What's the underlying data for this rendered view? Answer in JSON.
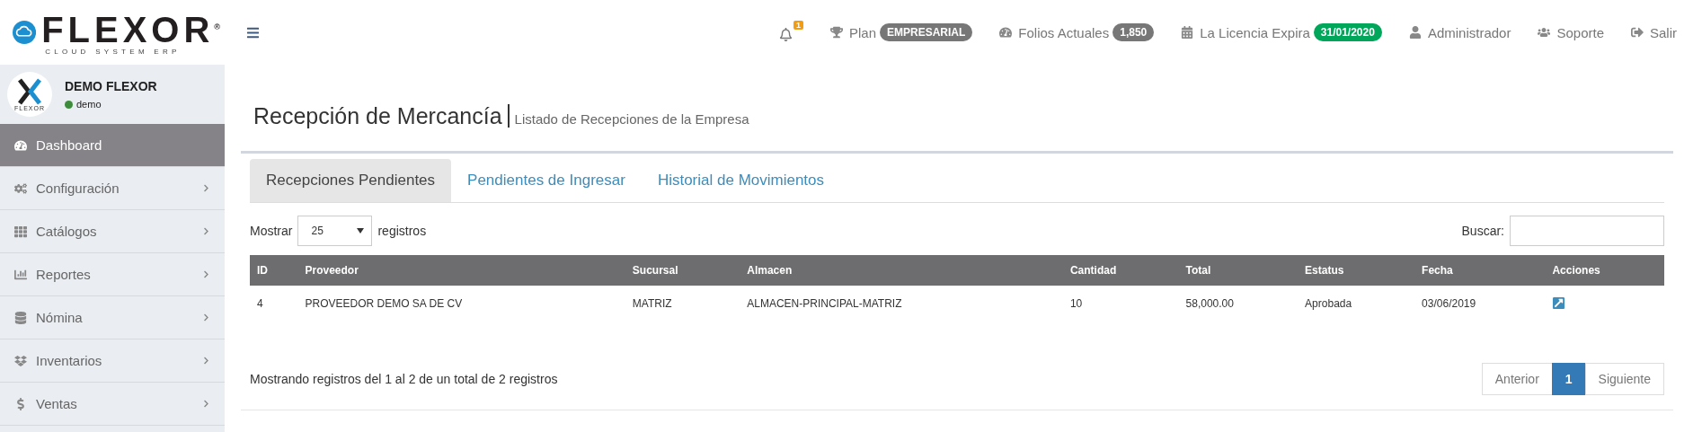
{
  "brand": {
    "name": "FLEXOR",
    "mark": "®",
    "tagline": "CLOUD SYSTEM ERP"
  },
  "topbar": {
    "notifications": "1",
    "items": [
      {
        "kind": "badge",
        "label": "Plan",
        "badge": "EMPRESARIAL",
        "color": "#777777"
      },
      {
        "kind": "badge",
        "label": "Folios Actuales",
        "badge": "1,850",
        "color": "#777777"
      },
      {
        "kind": "badge",
        "label": "La Licencia Expira",
        "badge": "31/01/2020",
        "color": "#00a65a"
      },
      {
        "kind": "link",
        "label": "Administrador"
      },
      {
        "kind": "link",
        "label": "Soporte"
      },
      {
        "kind": "link",
        "label": "Salir"
      }
    ]
  },
  "user": {
    "avatar_text": "FLEXOR",
    "name": "DEMO FLEXOR",
    "status": "demo",
    "online": true
  },
  "sidebar": {
    "items": [
      {
        "label": "Dashboard",
        "selected": true,
        "has_children": false
      },
      {
        "label": "Configuración",
        "selected": false,
        "has_children": true
      },
      {
        "label": "Catálogos",
        "selected": false,
        "has_children": true
      },
      {
        "label": "Reportes",
        "selected": false,
        "has_children": true
      },
      {
        "label": "Nómina",
        "selected": false,
        "has_children": true
      },
      {
        "label": "Inventarios",
        "selected": false,
        "has_children": true
      },
      {
        "label": "Ventas",
        "selected": false,
        "has_children": true
      }
    ]
  },
  "page": {
    "title": "Recepción de Mercancía",
    "subtitle": "Listado de Recepciones de la Empresa"
  },
  "tabs": [
    {
      "label": "Recepciones Pendientes",
      "selected": true
    },
    {
      "label": "Pendientes de Ingresar",
      "selected": false
    },
    {
      "label": "Historial de Movimientos",
      "selected": false
    }
  ],
  "length": {
    "before": "Mostrar",
    "value": "25",
    "after": "registros"
  },
  "search": {
    "label": "Buscar:"
  },
  "table": {
    "columns": [
      "ID",
      "Proveedor",
      "Sucursal",
      "Almacen",
      "Cantidad",
      "Total",
      "Estatus",
      "Fecha",
      "Acciones"
    ],
    "rows": [
      [
        "4",
        "PROVEEDOR DEMO SA DE CV",
        "MATRIZ",
        "ALMACEN-PRINCIPAL-MATRIZ",
        "10",
        "58,000.00",
        "Aprobada",
        "03/06/2019"
      ]
    ]
  },
  "info": "Mostrando registros del 1 al 2 de un total de 2 registros",
  "pagination": [
    {
      "label": "Anterior",
      "selected": false
    },
    {
      "label": "1",
      "selected": true
    },
    {
      "label": "Siguiente",
      "selected": false
    }
  ]
}
